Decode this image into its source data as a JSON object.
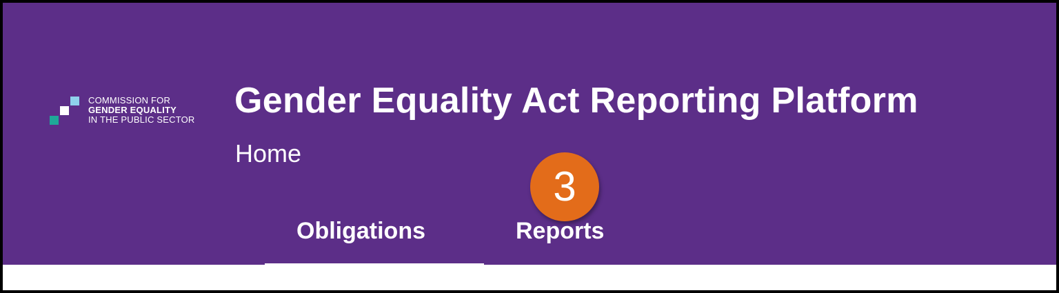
{
  "logo": {
    "line1": "COMMISSION FOR",
    "line2": "GENDER EQUALITY",
    "line3": "IN THE PUBLIC SECTOR"
  },
  "header": {
    "title": "Gender Equality Act Reporting Platform",
    "subtitle": "Home"
  },
  "annotation": {
    "step_number": "3"
  },
  "tabs": [
    {
      "label": "Obligations",
      "active": true
    },
    {
      "label": "Reports",
      "active": false
    }
  ],
  "colors": {
    "header_bg": "#5c2e88",
    "badge": "#e36c1a",
    "logo_light_blue": "#8fd1ec",
    "logo_teal": "#1fa898"
  }
}
